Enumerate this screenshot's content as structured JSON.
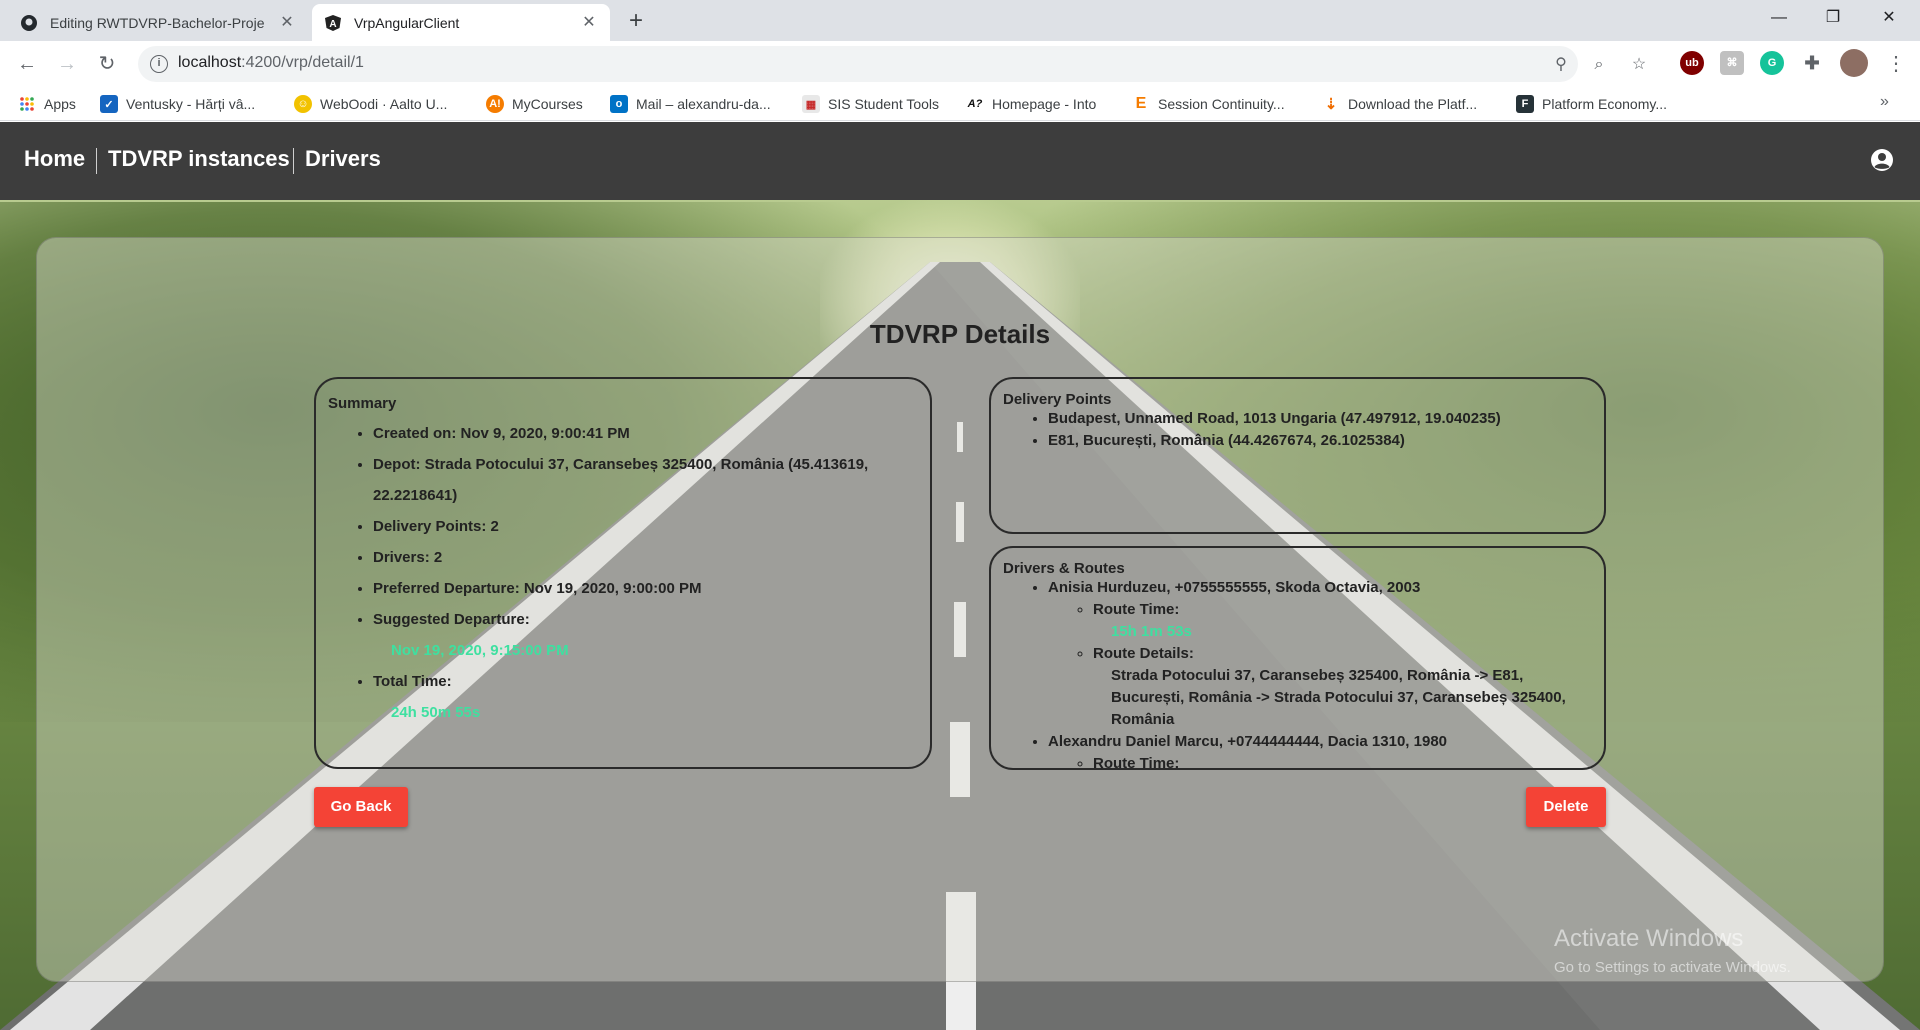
{
  "browser": {
    "tabs": [
      {
        "title": "Editing RWTDVRP-Bachelor-Proje",
        "icon": "github-icon"
      },
      {
        "title": "VrpAngularClient",
        "icon": "angular-icon"
      }
    ],
    "url_host": "localhost",
    "url_path": ":4200/vrp/detail/1",
    "bookmarks": [
      {
        "label": "Apps",
        "icon": "apps-grid-icon"
      },
      {
        "label": "Ventusky - Hărți vâ...",
        "icon": "ventusky-icon"
      },
      {
        "label": "WebOodi · Aalto U...",
        "icon": "weboodi-icon"
      },
      {
        "label": "MyCourses",
        "icon": "mycourses-icon"
      },
      {
        "label": "Mail – alexandru-da...",
        "icon": "outlook-icon"
      },
      {
        "label": "SIS Student Tools",
        "icon": "sis-icon"
      },
      {
        "label": "Homepage - Into",
        "icon": "into-icon"
      },
      {
        "label": "Session Continuity...",
        "icon": "session-icon"
      },
      {
        "label": "Download the Platf...",
        "icon": "download-icon"
      },
      {
        "label": "Platform Economy...",
        "icon": "platform-icon"
      }
    ]
  },
  "nav": {
    "home": "Home",
    "instances": "TDVRP instances",
    "drivers": "Drivers"
  },
  "page_title": "TDVRP Details",
  "summary": {
    "title": "Summary",
    "created": "Created on: Nov 9, 2020, 9:00:41 PM",
    "depot_line1": "Depot: Strada Potocului 37, Caransebeș 325400, România (45.413619,",
    "depot_line2": "22.2218641)",
    "delivery_points": "Delivery Points: 2",
    "drivers": "Drivers: 2",
    "preferred_departure": "Preferred Departure: Nov 19, 2020, 9:00:00 PM",
    "suggested_label": "Suggested Departure:",
    "suggested_value": "Nov 19, 2020, 9:15:00 PM",
    "total_label": "Total Time:",
    "total_value": "24h 50m 55s"
  },
  "delivery": {
    "title": "Delivery Points",
    "points": [
      "Budapest, Unnamed Road, 1013 Ungaria (47.497912, 19.040235)",
      "E81, București, România (44.4267674, 26.1025384)"
    ]
  },
  "drivers_routes": {
    "title": "Drivers & Routes",
    "driver1": "Anisia Hurduzeu, +0755555555, Skoda Octavia, 2003",
    "route_time_label": "Route Time:",
    "driver1_time": "15h 1m 53s",
    "route_details_label": "Route Details:",
    "driver1_route": "Strada Potocului 37, Caransebeș 325400, România -> E81, București, România -> Strada Potocului 37, Caransebeș 325400, România",
    "driver2": "Alexandru Daniel Marcu, +0744444444, Dacia 1310, 1980",
    "driver2_route_time_label": "Route Time:"
  },
  "buttons": {
    "back": "Go Back",
    "delete": "Delete"
  },
  "watermark": {
    "line1": "Activate Windows",
    "line2": "Go to Settings to activate Windows."
  },
  "colors": {
    "navbar": "#3d3d3d",
    "button": "#f44336",
    "highlight": "#3ee0a0"
  }
}
